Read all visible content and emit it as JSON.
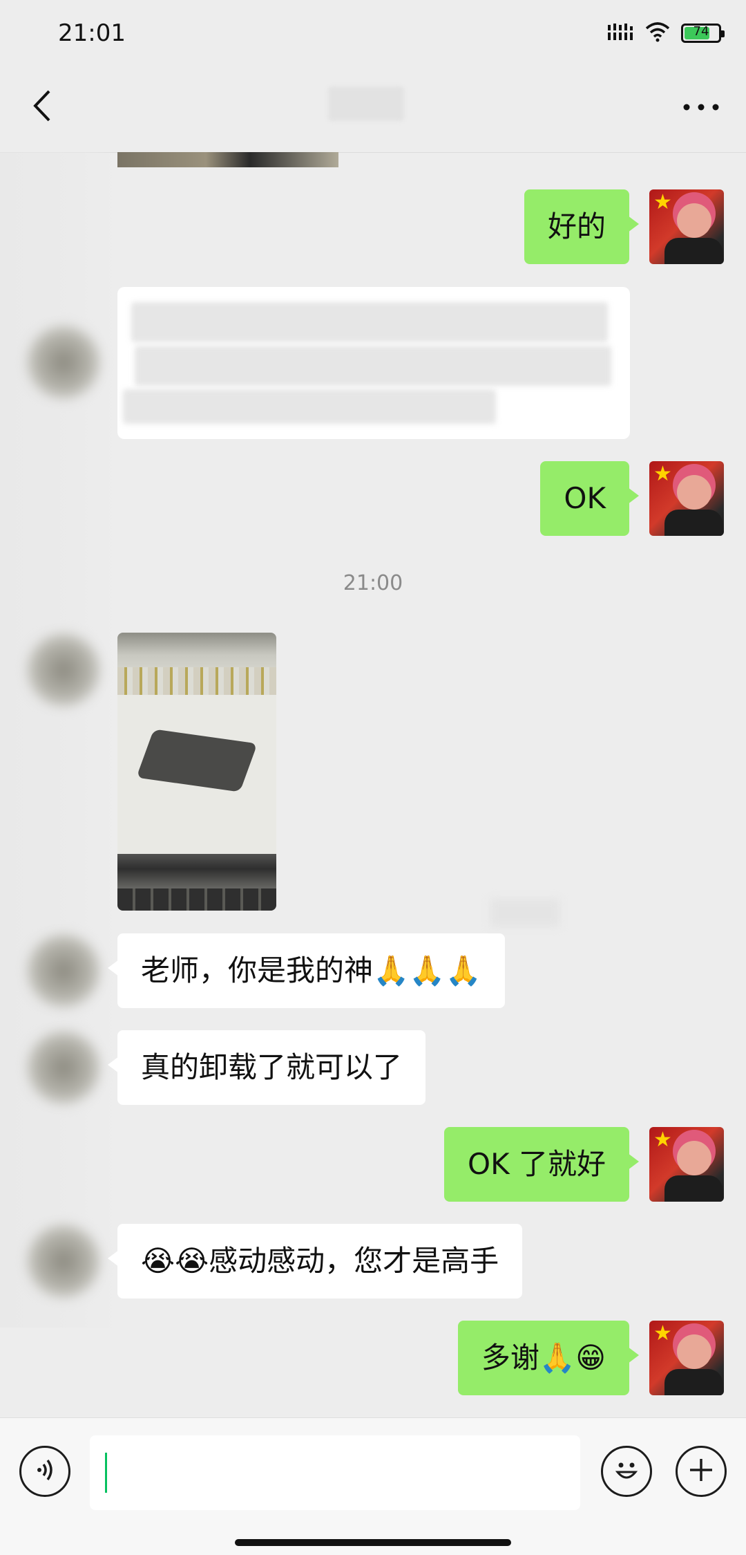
{
  "status_bar": {
    "time": "21:01",
    "battery": "74",
    "battery_level_percent": 74,
    "icons": [
      "signal-icon",
      "wifi-icon",
      "battery-icon"
    ]
  },
  "nav": {
    "title": "",
    "back_icon": "chevron-left-icon",
    "more_icon": "more-dots-icon"
  },
  "messages": [
    {
      "sender": "me",
      "type": "text",
      "text": "好的"
    },
    {
      "sender": "other",
      "type": "blurred-card",
      "text": ""
    },
    {
      "sender": "me",
      "type": "text",
      "text": "OK"
    },
    {
      "type": "timestamp",
      "text": "21:00"
    },
    {
      "sender": "other",
      "type": "image",
      "text": ""
    },
    {
      "sender": "other",
      "type": "text",
      "text": "老师，你是我的神🙏🙏🙏"
    },
    {
      "sender": "other",
      "type": "text",
      "text": "真的卸载了就可以了"
    },
    {
      "sender": "me",
      "type": "text",
      "text": "OK 了就好"
    },
    {
      "sender": "other",
      "type": "text",
      "text": "😭😭感动感动，您才是高手"
    },
    {
      "sender": "me",
      "type": "text",
      "text": "多谢🙏😁"
    }
  ],
  "input_bar": {
    "placeholder": "",
    "voice_icon": "voice-icon",
    "emoji_icon": "emoji-icon",
    "plus_icon": "plus-icon"
  },
  "colors": {
    "background": "#ededed",
    "my_bubble": "#95ec69",
    "other_bubble": "#ffffff",
    "accent_caret": "#07c160",
    "battery_fill": "#3cc85a"
  }
}
